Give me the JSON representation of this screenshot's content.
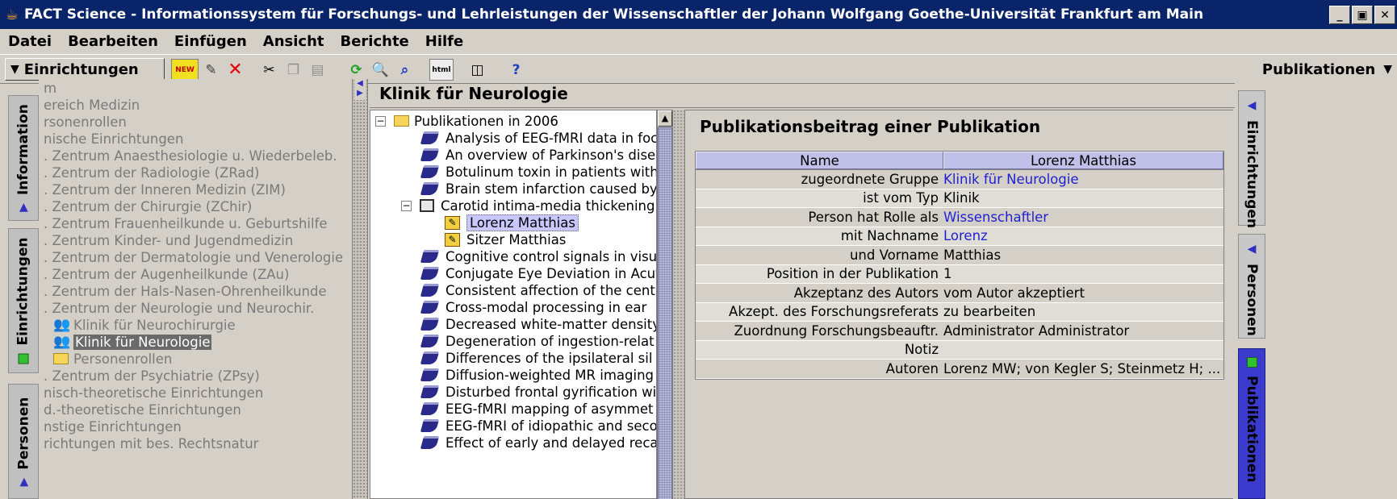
{
  "window": {
    "title": "FACT Science - Informationssystem für Forschungs- und Lehrleistungen der Wissenschaftler der Johann Wolfgang Goethe-Universität Frankfurt am Main",
    "min": "_",
    "max": "▣",
    "close": "✕"
  },
  "menu": [
    "Datei",
    "Bearbeiten",
    "Einfügen",
    "Ansicht",
    "Berichte",
    "Hilfe"
  ],
  "toolbar": {
    "left_dropdown": "Einrichtungen",
    "right_dropdown": "Publikationen",
    "new_label": "NEW",
    "html_label": "html"
  },
  "left_tabs": [
    "Information",
    "Einrichtungen",
    "Personen"
  ],
  "left_tree": [
    "m",
    "ereich Medizin",
    "rsonenrollen",
    "nische Einrichtungen",
    ". Zentrum Anaesthesiologie u. Wiederbeleb.",
    ". Zentrum der Radiologie (ZRad)",
    ". Zentrum der Inneren Medizin (ZIM)",
    ". Zentrum der Chirurgie (ZChir)",
    ". Zentrum Frauenheilkunde u. Geburtshilfe",
    ". Zentrum Kinder- und Jugendmedizin",
    ". Zentrum der Dermatologie und Venerologie",
    ". Zentrum der Augenheilkunde (ZAu)",
    ". Zentrum der Hals-Nasen-Ohrenheilkunde",
    ". Zentrum der Neurologie und Neurochir.",
    "Klinik für Neurochirurgie",
    "Klinik für Neurologie",
    "Personenrollen",
    ". Zentrum der Psychiatrie (ZPsy)",
    "nisch-theoretische Einrichtungen",
    "d.-theoretische Einrichtungen",
    "nstige Einrichtungen",
    "richtungen mit bes. Rechtsnatur"
  ],
  "panel_title": "Klinik für Neurologie",
  "pub_tree": {
    "root": "Publikationen in 2006",
    "items_before": [
      "Analysis of EEG-fMRI data in foc",
      "An overview of Parkinson's dise",
      "Botulinum toxin in patients with",
      "Brain stem infarction caused by"
    ],
    "expanded": "Carotid intima-media thickening",
    "children": [
      "Lorenz Matthias",
      "Sitzer Matthias"
    ],
    "items_after": [
      "Cognitive control signals in visu",
      "Conjugate Eye Deviation in Acut",
      "Consistent affection of the centr",
      "Cross-modal processing in ear",
      "Decreased white-matter density",
      "Degeneration of ingestion-relat",
      "Differences of the ipsilateral sil",
      "Diffusion-weighted MR imaging",
      "Disturbed frontal gyrification wit",
      "EEG-fMRI mapping of asymmet",
      "EEG-fMRI of idiopathic and seco",
      "Effect of early and delayed reca"
    ]
  },
  "detail": {
    "title": "Publikationsbeitrag einer Publikation",
    "header": [
      "Name",
      "Lorenz Matthias"
    ],
    "rows": [
      {
        "k": "zugeordnete Gruppe",
        "v": "Klinik für Neurologie",
        "link": true
      },
      {
        "k": "ist vom Typ",
        "v": "Klinik",
        "link": false
      },
      {
        "k": "Person hat Rolle als",
        "v": "Wissenschaftler",
        "link": true
      },
      {
        "k": "mit Nachname",
        "v": "Lorenz",
        "link": true
      },
      {
        "k": "und Vorname",
        "v": "Matthias",
        "link": false
      },
      {
        "k": "Position in der Publikation",
        "v": "1",
        "link": false
      },
      {
        "k": "Akzeptanz des Autors",
        "v": "vom Autor akzeptiert",
        "link": false
      },
      {
        "k": "Akzept. des Forschungsreferats",
        "v": "zu bearbeiten",
        "link": false
      },
      {
        "k": "Zuordnung Forschungsbeauftr.",
        "v": "Administrator Administrator",
        "link": false
      },
      {
        "k": "Notiz",
        "v": "",
        "link": false
      },
      {
        "k": "Autoren",
        "v": "Lorenz MW; von Kegler S; Steinmetz H; ...",
        "link": false
      }
    ]
  },
  "right_tabs": [
    "Einrichtungen",
    "Personen",
    "Publikationen"
  ],
  "colors": {
    "titlebar": "#0a246a",
    "link": "#2020d0",
    "selected_tab": "#3a3acc",
    "table_header": "#c0c0e8"
  }
}
